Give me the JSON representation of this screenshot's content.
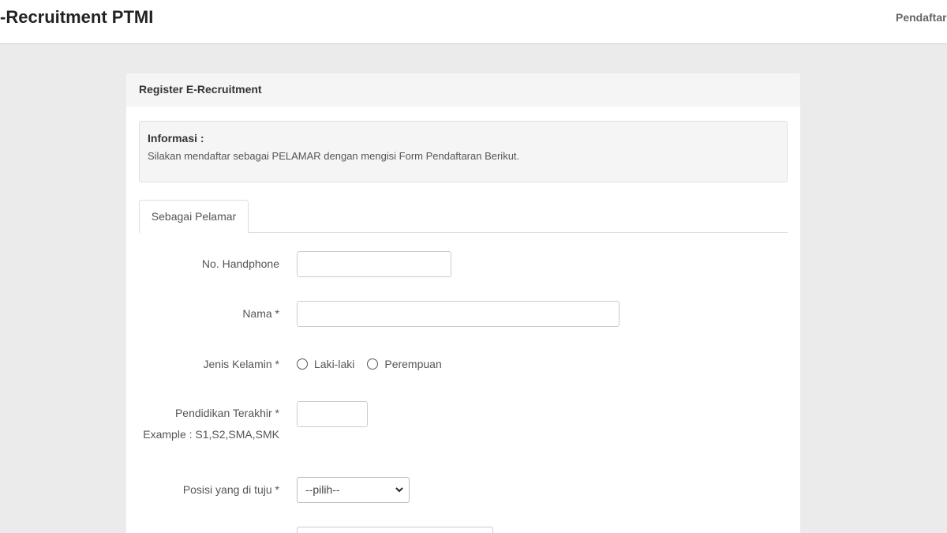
{
  "header": {
    "brand": "-Recruitment PTMI",
    "nav_link": "Pendaftar"
  },
  "panel": {
    "title": "Register E-Recruitment",
    "info_title": "Informasi :",
    "info_text": "Silakan mendaftar sebagai PELAMAR dengan mengisi Form Pendaftaran Berikut."
  },
  "tabs": [
    {
      "label": "Sebagai Pelamar",
      "active": true
    }
  ],
  "form": {
    "phone_label": "No. Handphone",
    "phone_value": "",
    "name_label": "Nama *",
    "name_value": "",
    "gender_label": "Jenis Kelamin *",
    "gender_options": [
      "Laki-laki",
      "Perempuan"
    ],
    "education_label": "Pendidikan Terakhir *",
    "education_hint": "Example : S1,S2,SMA,SMK",
    "education_value": "",
    "position_label": "Posisi yang di tuju *",
    "position_selected": "--pilih--"
  },
  "icons": {
    "select_arrow": "chevron-down-icon"
  }
}
